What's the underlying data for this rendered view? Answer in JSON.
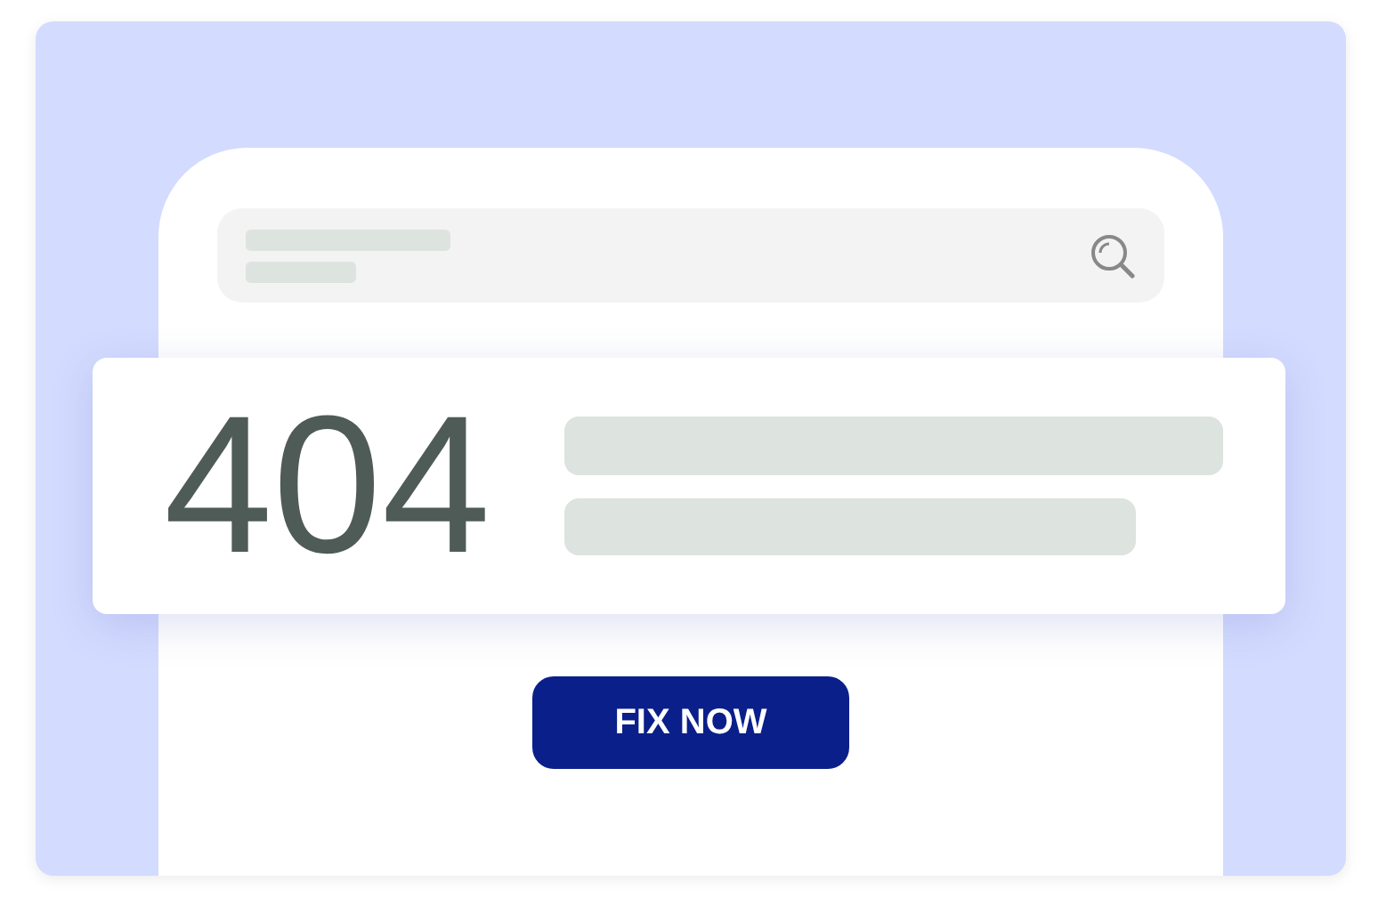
{
  "error_card": {
    "code": "404"
  },
  "button": {
    "label": "FIX NOW"
  }
}
